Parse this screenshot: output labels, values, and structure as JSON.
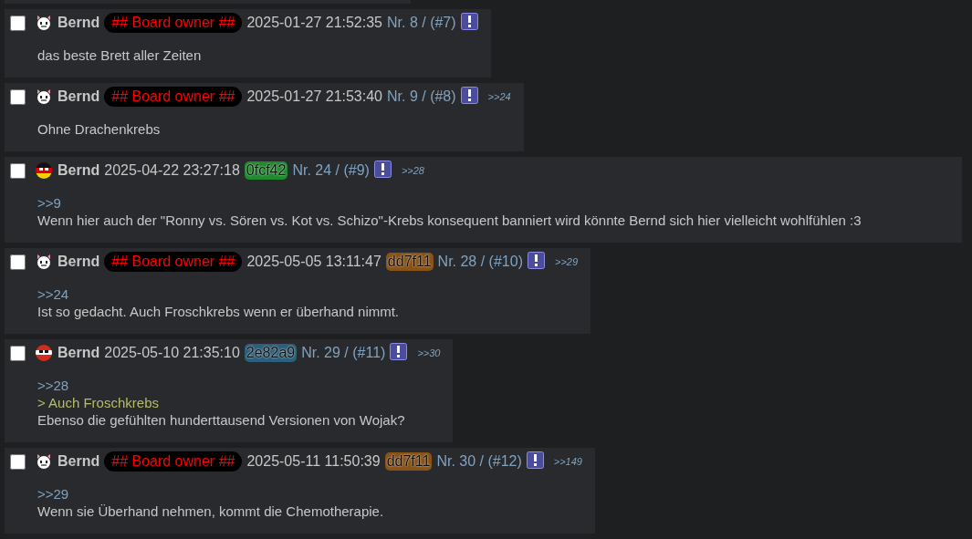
{
  "posts": [
    {
      "kind": "cat",
      "name": "Bernd",
      "capcode": "## Board owner ##",
      "date": "2025-01-27 21:52:35",
      "number": "Nr. 8 / (#7)",
      "body": [
        {
          "kind": "text",
          "text": "das beste Brett aller Zeiten"
        }
      ],
      "checked": false
    },
    {
      "kind": "cat",
      "name": "Bernd",
      "capcode": "## Board owner ##",
      "date": "2025-01-27 21:53:40",
      "number": "Nr. 9 / (#8)",
      "backlinks": [
        ">>24"
      ],
      "body": [
        {
          "kind": "text",
          "text": "Ohne Drachenkrebs"
        }
      ],
      "checked": false
    },
    {
      "kind": "germany",
      "name": "Bernd",
      "date": "2025-04-22 23:27:18",
      "poster_id": {
        "text": "0fcf42",
        "color": "#1f8a2e"
      },
      "number": "Nr. 24 / (#9)",
      "backlinks": [
        ">>28"
      ],
      "body": [
        {
          "kind": "quote-link",
          "text": ">>9"
        },
        {
          "kind": "text",
          "text": "Wenn hier auch der \"Ronny vs. Sören vs. Kot vs. Schizo\"-Krebs konsequent banniert wird könnte Bernd sich hier vielleicht wohlfühlen :3"
        }
      ],
      "checked": false
    },
    {
      "kind": "cat",
      "name": "Bernd",
      "capcode": "## Board owner ##",
      "date": "2025-05-05 13:11:47",
      "poster_id": {
        "text": "dd7f11",
        "color": "#8a5316"
      },
      "number": "Nr. 28 / (#10)",
      "backlinks": [
        ">>29"
      ],
      "body": [
        {
          "kind": "quote-link",
          "text": ">>24"
        },
        {
          "kind": "text",
          "text": "Ist so gedacht. Auch Froschkrebs wenn er überhand nimmt."
        }
      ],
      "checked": false
    },
    {
      "kind": "red-white",
      "name": "Bernd",
      "date": "2025-05-10 21:35:10",
      "poster_id": {
        "text": "2e82a9",
        "color": "#2b5f7a"
      },
      "number": "Nr. 29 / (#11)",
      "backlinks": [
        ">>30"
      ],
      "body": [
        {
          "kind": "quote-link",
          "text": ">>28"
        },
        {
          "kind": "greentext",
          "text": "> Auch Froschkrebs"
        },
        {
          "kind": "text",
          "text": "Ebenso die gefühlten hunderttausend Versionen von Wojak?"
        }
      ],
      "checked": false
    },
    {
      "kind": "cat",
      "name": "Bernd",
      "capcode": "## Board owner ##",
      "date": "2025-05-11 11:50:39",
      "poster_id": {
        "text": "dd7f11",
        "color": "#8a5316"
      },
      "number": "Nr. 30 / (#12)",
      "backlinks": [
        ">>149"
      ],
      "body": [
        {
          "kind": "quote-link",
          "text": ">>29"
        },
        {
          "kind": "text",
          "text": "Wenn sie Überhand nehmen, kommt die Chemotherapie."
        }
      ],
      "checked": false
    }
  ]
}
